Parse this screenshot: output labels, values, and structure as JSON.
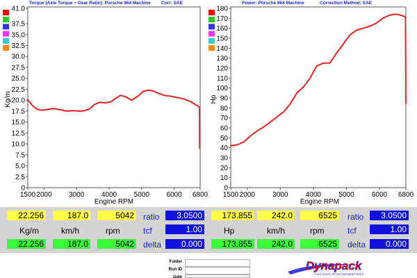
{
  "colors": {
    "curve": "#dd2222",
    "header_text": "#1a1ad6",
    "swatches": [
      "#ff0000",
      "#22cc22",
      "#3333ff",
      "#ff33ff",
      "#33cccc",
      "#ff8800"
    ],
    "readout_yellow": "#ffff4a",
    "readout_green": "#3cff3c",
    "readout_blue": "#1111dd",
    "brand_red": "#dd1111"
  },
  "chart_data": [
    {
      "type": "line",
      "title": "Torque (Axle Torque ÷ Gear Ratio): Porsche 964 Machine",
      "correction": "Corr: SAE",
      "xlabel": "Engine RPM",
      "ylabel": "Kg/m",
      "xlim": [
        1500,
        6800
      ],
      "ylim": [
        0,
        41.0
      ],
      "xticks": [
        "1500",
        "2000",
        "3000",
        "4000",
        "5000",
        "6000",
        "6800"
      ],
      "xtick_values": [
        1500,
        2000,
        3000,
        4000,
        5000,
        6000,
        6800
      ],
      "yticks": [
        "0",
        "2.5",
        "5.0",
        "7.5",
        "10.0",
        "12.5",
        "15.0",
        "17.5",
        "20.0",
        "22.5",
        "25.0",
        "27.5",
        "30.0",
        "32.5",
        "35.0",
        "37.5",
        "41.0"
      ],
      "ytick_values": [
        0,
        2.5,
        5,
        7.5,
        10,
        12.5,
        15,
        17.5,
        20,
        22.5,
        25,
        27.5,
        30,
        32.5,
        35,
        37.5,
        41
      ],
      "grid": false,
      "series": [
        {
          "x": [
            1500,
            1650,
            1800,
            1950,
            2100,
            2300,
            2500,
            2700,
            2900,
            3100,
            3250,
            3400,
            3550,
            3700,
            3900,
            4050,
            4200,
            4350,
            4500,
            4700,
            4900,
            5050,
            5200,
            5350,
            5500,
            5700,
            5900,
            6100,
            6300,
            6500,
            6650,
            6750,
            6780,
            6785
          ],
          "y": [
            20.1,
            18.7,
            17.9,
            17.7,
            17.9,
            18.1,
            17.8,
            17.5,
            17.6,
            17.5,
            17.6,
            18.0,
            19.0,
            19.5,
            19.4,
            19.6,
            20.4,
            21.1,
            20.8,
            20.0,
            21.0,
            22.0,
            22.3,
            22.1,
            21.6,
            21.1,
            20.9,
            20.6,
            20.3,
            19.7,
            19.0,
            18.6,
            18.3,
            9.0
          ]
        }
      ]
    },
    {
      "type": "line",
      "title": "Power: Porsche 964 Machine",
      "correction": "Correction Method: SAE",
      "xlabel": "Engine RPM",
      "ylabel": "Hp",
      "xlim": [
        1500,
        6800
      ],
      "ylim": [
        0,
        180
      ],
      "xticks": [
        "1500",
        "2000",
        "3000",
        "4000",
        "5000",
        "6000",
        "6800"
      ],
      "xtick_values": [
        1500,
        2000,
        3000,
        4000,
        5000,
        6000,
        6800
      ],
      "yticks": [
        "0",
        "10",
        "20",
        "30",
        "40",
        "50",
        "60",
        "70",
        "80",
        "90",
        "100",
        "110",
        "120",
        "130",
        "140",
        "150",
        "160",
        "170",
        "180"
      ],
      "ytick_values": [
        0,
        10,
        20,
        30,
        40,
        50,
        60,
        70,
        80,
        90,
        100,
        110,
        120,
        130,
        140,
        150,
        160,
        170,
        180
      ],
      "grid": false,
      "series": [
        {
          "x": [
            1500,
            1700,
            1900,
            2100,
            2300,
            2500,
            2700,
            2900,
            3100,
            3300,
            3500,
            3700,
            3900,
            4100,
            4300,
            4500,
            4700,
            4900,
            5100,
            5300,
            5500,
            5700,
            5900,
            6100,
            6300,
            6450,
            6550,
            6650,
            6750,
            6790,
            6800
          ],
          "y": [
            42,
            43,
            46,
            52,
            57,
            61,
            66,
            71,
            76,
            84,
            95,
            101,
            110,
            122,
            125,
            125,
            135,
            144,
            153,
            158,
            160,
            162,
            165,
            170,
            173,
            174,
            174,
            173,
            172,
            171,
            85
          ]
        }
      ]
    }
  ],
  "readouts": {
    "left": {
      "top": [
        "22.256",
        "187.0",
        "5042"
      ],
      "units": [
        "Kg/m",
        "km/h",
        "rpm"
      ],
      "bottom": [
        "22.256",
        "187.0",
        "5042"
      ],
      "ratio_label": "ratio",
      "ratio_value": "3.0500",
      "tcf_label": "tcf",
      "tcf_value": "1.00",
      "delta_label": "delta",
      "delta_value": "0.000"
    },
    "right": {
      "top": [
        "173.855",
        "242.0",
        "6525"
      ],
      "units": [
        "Hp",
        "km/h",
        "rpm"
      ],
      "bottom": [
        "173.855",
        "242.0",
        "6525"
      ],
      "ratio_label": "ratio",
      "ratio_value": "3.0500",
      "tcf_label": "tcf",
      "tcf_value": "1.00",
      "delta_label": "delta",
      "delta_value": "0.000"
    }
  },
  "footer": {
    "folder_label": "Folder",
    "run_id_label": "Run ID",
    "date_label": "Date",
    "brand": "Dynapack",
    "brand_tagline": "CHASSIS DYNAMOMETERS"
  }
}
